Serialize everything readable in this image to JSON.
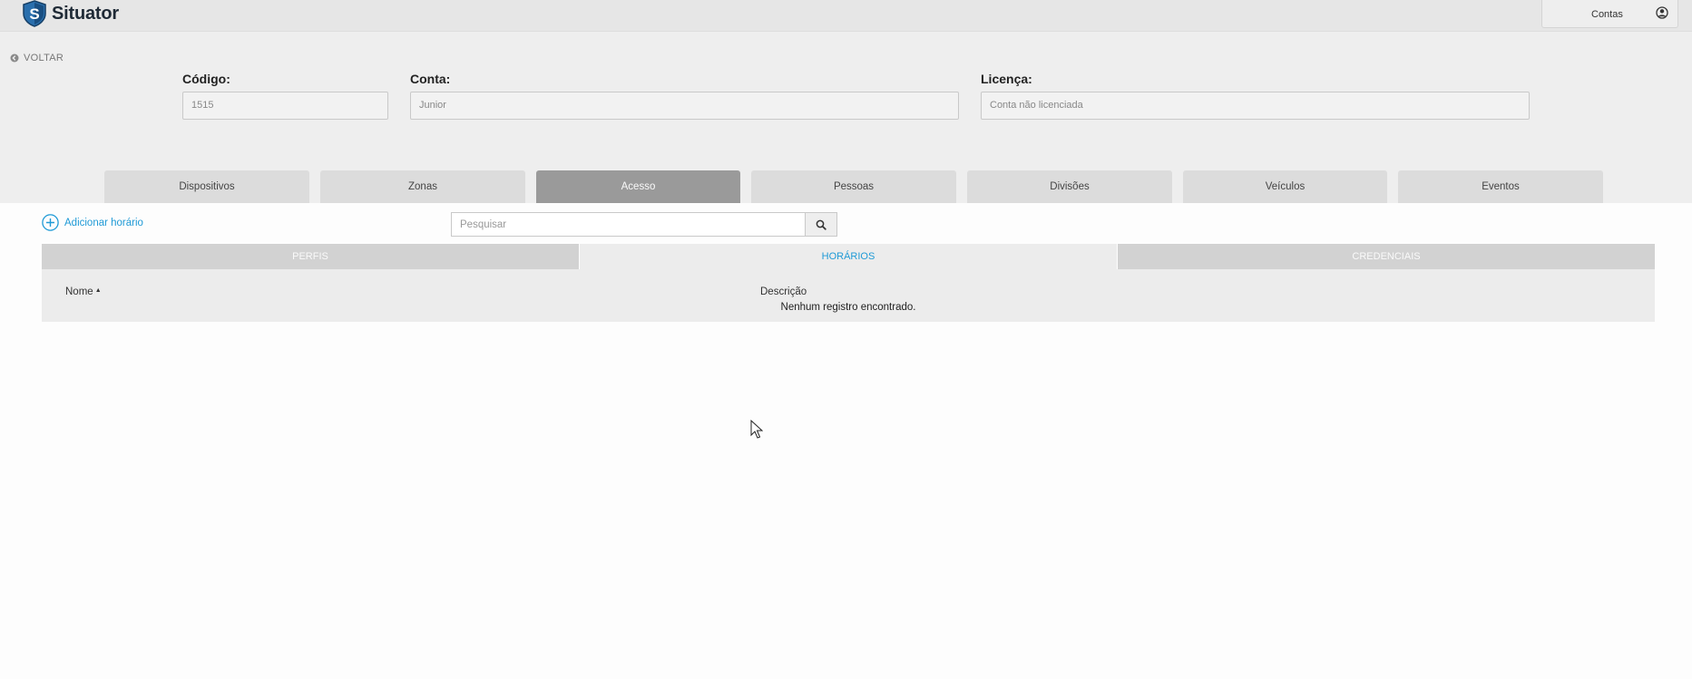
{
  "app": {
    "name": "Situator"
  },
  "header": {
    "account_label": "Contas"
  },
  "back_label": "VOLTAR",
  "form": {
    "codigo_label": "Código:",
    "codigo_value": "1515",
    "conta_label": "Conta:",
    "conta_value": "Junior",
    "licenca_label": "Licença:",
    "licenca_value": "Conta não licenciada"
  },
  "main_tabs": [
    {
      "label": "Dispositivos"
    },
    {
      "label": "Zonas"
    },
    {
      "label": "Acesso",
      "active": true
    },
    {
      "label": "Pessoas"
    },
    {
      "label": "Divisões"
    },
    {
      "label": "Veículos"
    },
    {
      "label": "Eventos"
    }
  ],
  "add_label": "Adicionar horário",
  "search": {
    "placeholder": "Pesquisar"
  },
  "sub_tabs": [
    {
      "label": "PERFIS"
    },
    {
      "label": "HORÁRIOS",
      "active": true
    },
    {
      "label": "CREDENCIAIS"
    }
  ],
  "table": {
    "columns": [
      "Nome",
      "Descrição"
    ],
    "empty_message": "Nenhum registro encontrado."
  },
  "colors": {
    "accent": "#1f9ad6",
    "active_tab": "#9a9a9a",
    "header_bg": "#e6e6e6",
    "panel_bg": "#eeeeee",
    "logo_shield": "#1f5f99"
  }
}
